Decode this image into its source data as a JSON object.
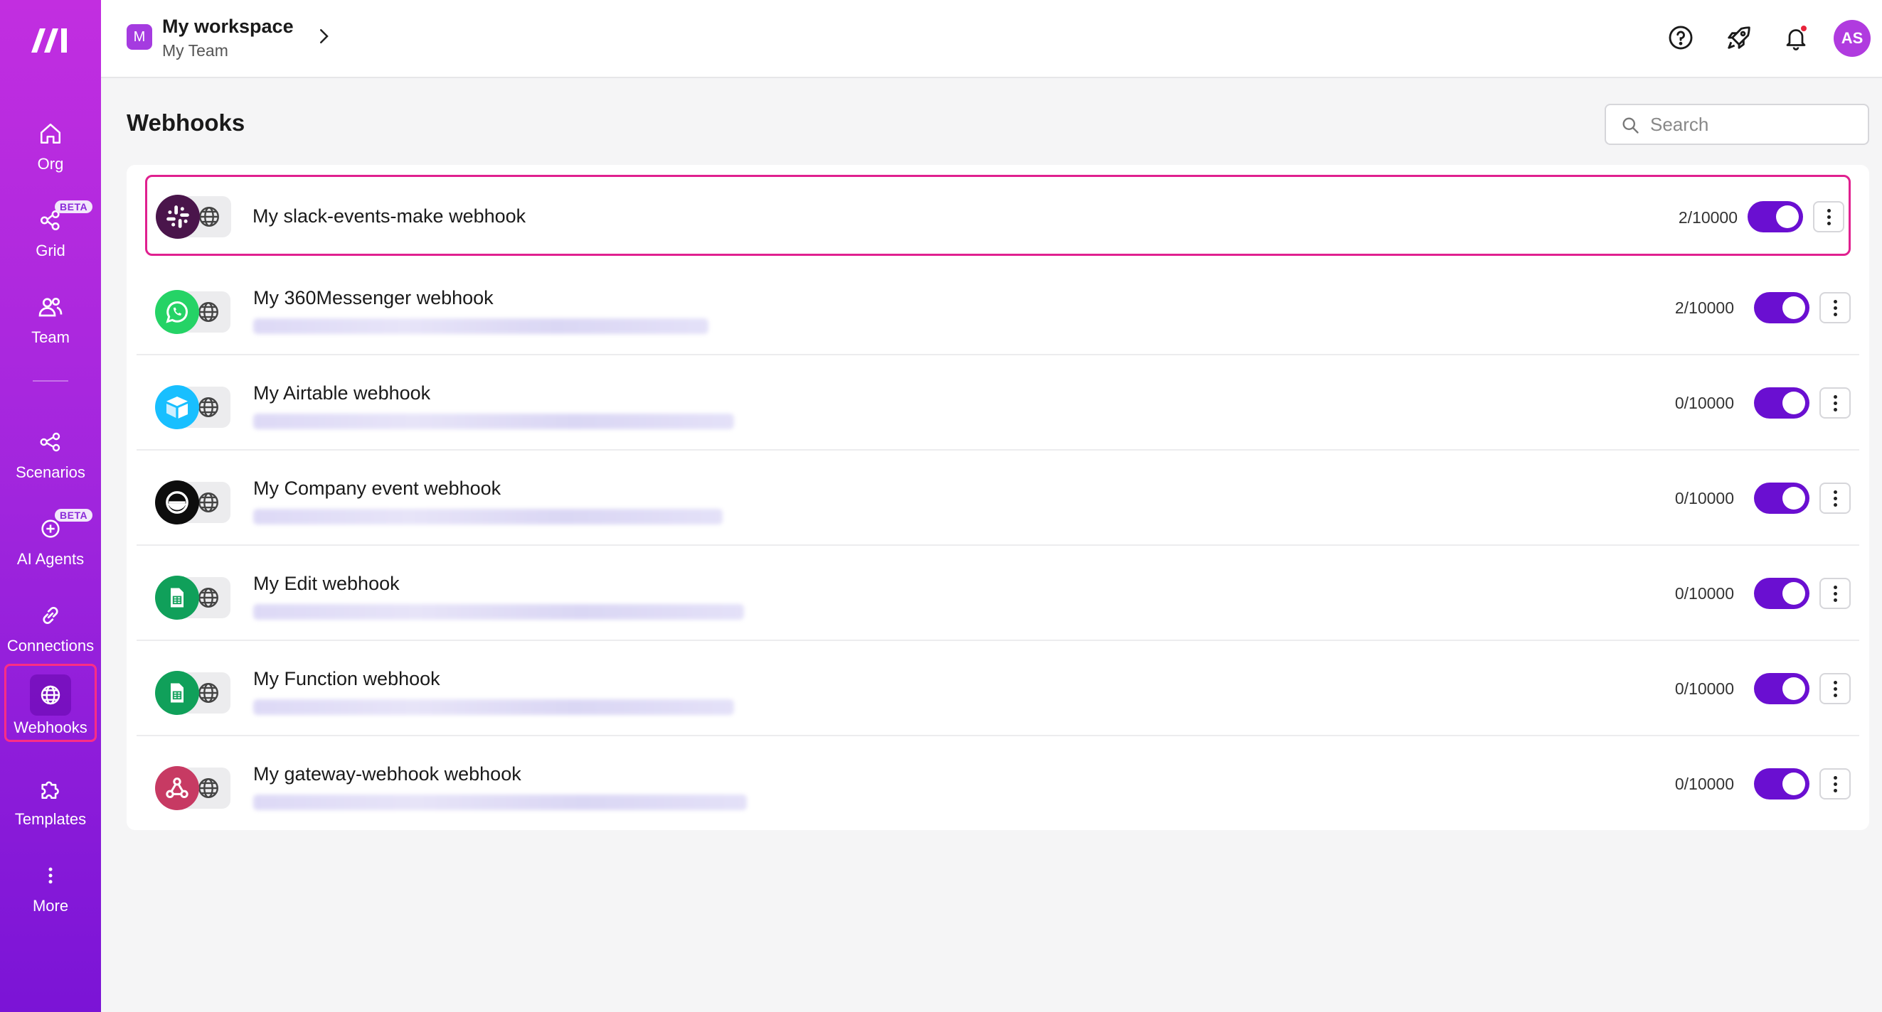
{
  "sidebar": {
    "items": [
      {
        "label": "Org",
        "icon": "home-icon"
      },
      {
        "label": "Grid",
        "icon": "grid-icon",
        "badge": "BETA"
      },
      {
        "label": "Team",
        "icon": "team-icon"
      },
      {
        "label": "Scenarios",
        "icon": "share-icon"
      },
      {
        "label": "AI Agents",
        "icon": "ai-agent-icon",
        "badge": "BETA"
      },
      {
        "label": "Connections",
        "icon": "link-icon"
      },
      {
        "label": "Webhooks",
        "icon": "globe-icon",
        "active": true
      },
      {
        "label": "Templates",
        "icon": "puzzle-icon"
      },
      {
        "label": "More",
        "icon": "more-vertical-icon"
      }
    ]
  },
  "header": {
    "workspace_initial": "M",
    "workspace_name": "My workspace",
    "team_name": "My Team",
    "avatar_initials": "AS"
  },
  "page": {
    "title": "Webhooks",
    "search_placeholder": "Search"
  },
  "webhooks": [
    {
      "name": "My slack-events-make webhook",
      "usage": "2/10000",
      "app": "slack",
      "enabled": true,
      "selected": true
    },
    {
      "name": "My 360Messenger webhook",
      "usage": "2/10000",
      "app": "whatsapp",
      "enabled": true
    },
    {
      "name": "My Airtable webhook",
      "usage": "0/10000",
      "app": "airtable",
      "enabled": true
    },
    {
      "name": "My Company event webhook",
      "usage": "0/10000",
      "app": "company",
      "enabled": true
    },
    {
      "name": "My Edit webhook",
      "usage": "0/10000",
      "app": "google-sheets",
      "enabled": true
    },
    {
      "name": "My Function webhook",
      "usage": "0/10000",
      "app": "google-sheets",
      "enabled": true
    },
    {
      "name": "My gateway-webhook webhook",
      "usage": "0/10000",
      "app": "webhooks",
      "enabled": true
    }
  ],
  "colors": {
    "accent": "#6a0fd1",
    "sidebar_top": "#c22ee0",
    "sidebar_bottom": "#7b14d6",
    "highlight": "#e0208f"
  }
}
